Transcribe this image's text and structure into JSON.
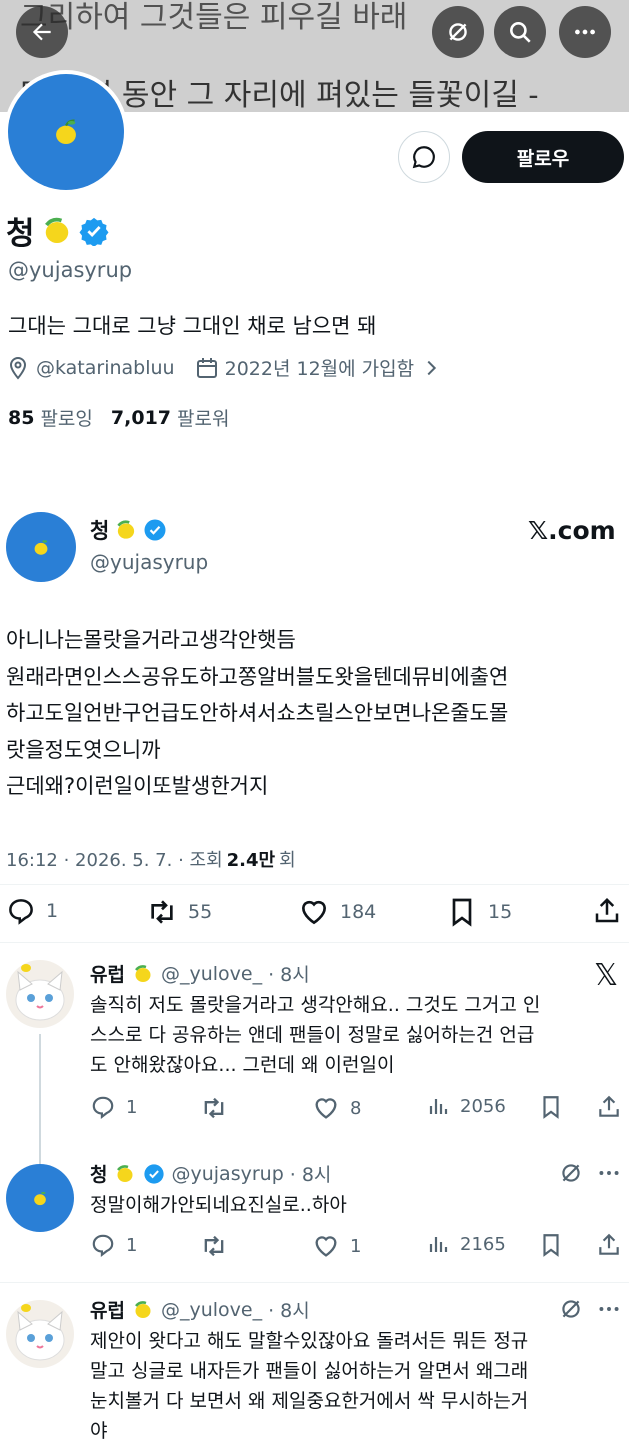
{
  "banner": {
    "line1": "그리하여 그것들은 피우길 바래",
    "line2": "몇 십년 동안 그 자리에 펴있는 들꽃이길 -"
  },
  "profile": {
    "name": "청",
    "handle": "@yujasyrup",
    "bio": "그대는 그대로 그냥 그대인 채로 남으면 돼",
    "location": "@katarinabluu",
    "joined": "2022년 12월에 가입함",
    "following_count": "85",
    "following_label": "팔로잉",
    "followers_count": "7,017",
    "followers_label": "팔로워",
    "follow_button": "팔로우"
  },
  "tweet": {
    "name": "청",
    "handle": "@yujasyrup",
    "source": "𝕏.com",
    "body_lines": [
      "아니나는몰랏을거라고생각안햇듬",
      "원래라면인스스공유도하고쫑알버블도왓을텐데뮤비에출연",
      "하고도일언반구언급도안하셔서쇼츠릴스안보면나온줄도몰",
      "랏을정도엿으니까",
      "근데왜?이런일이또발생한거지"
    ],
    "meta_time": "16:12 · 2026. 5. 7. · 조회",
    "views": "2.4만",
    "views_suffix": "회",
    "replies": "1",
    "retweets": "55",
    "likes": "184",
    "bookmarks": "15"
  },
  "replies": [
    {
      "name": "유럽",
      "handle": "@_yulove_",
      "time": "· 8시",
      "lines": [
        "솔직히 저도 몰랏을거라고 생각안해요.. 그것도 그거고 인",
        "스스로 다 공유하는 앤데 팬들이 정말로 싫어하는건 언급",
        "도 안해왔잖아요... 그런데 왜 이런일이"
      ],
      "replies": "1",
      "retweets": "",
      "likes": "8",
      "views": "2056"
    },
    {
      "name": "청",
      "handle": "@yujasyrup",
      "time": "· 8시",
      "lines": [
        "정말이해가안되네요진실로..하아"
      ],
      "replies": "1",
      "retweets": "",
      "likes": "1",
      "views": "2165"
    },
    {
      "name": "유럽",
      "handle": "@_yulove_",
      "time": "· 8시",
      "lines": [
        "제안이 왓다고 해도 말할수있잖아요 돌려서든 뭐든 정규",
        "말고 싱글로 내자든가 팬들이 싫어하는거 알면서 왜그래",
        "눈치볼거 다 보면서 왜 제일중요한거에서 싹 무시하는거",
        "야"
      ]
    }
  ],
  "colors": {
    "accent": "#1d9bf0",
    "text": "#0f1419",
    "secondary": "#536471"
  }
}
